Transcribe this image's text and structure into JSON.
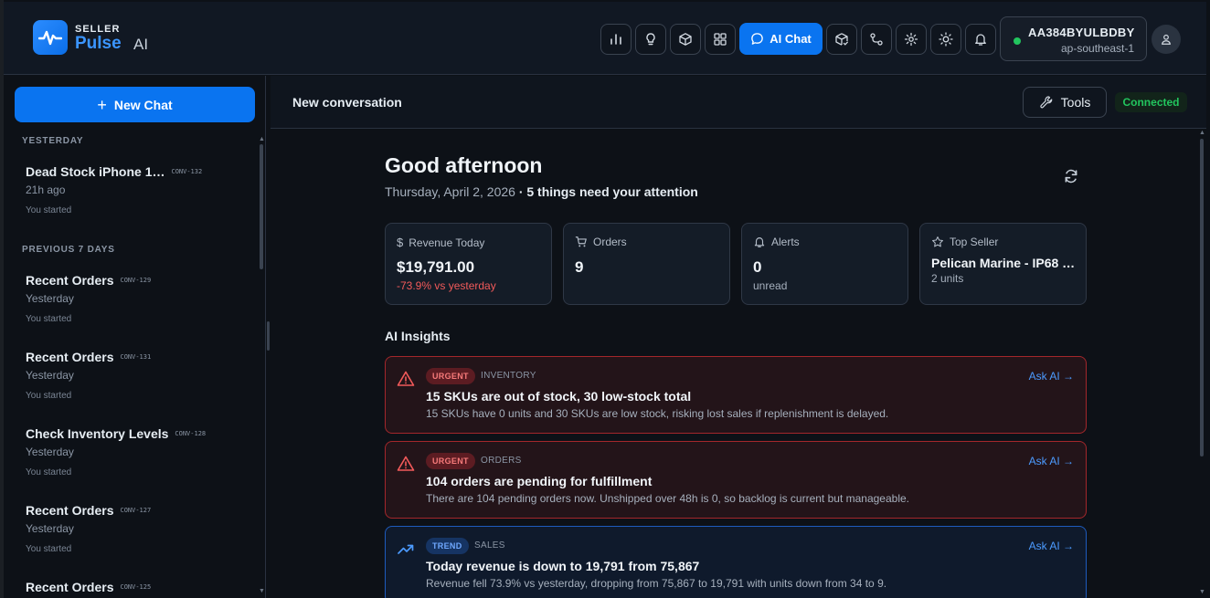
{
  "brand": {
    "top": "SELLER",
    "name": "Pulse",
    "suffix": "AI"
  },
  "header": {
    "ai_chat_label": "AI Chat",
    "account_id": "AA384BYULBDBY",
    "region": "ap-southeast-1",
    "status_color": "#22c55e",
    "accent": "#0a74f0"
  },
  "sidebar": {
    "new_chat_label": "New Chat",
    "sections": [
      {
        "label": "YESTERDAY"
      },
      {
        "label": "PREVIOUS 7 DAYS"
      }
    ],
    "conversations": [
      {
        "title": "Dead Stock iPhone 1…",
        "id": "CONV-132",
        "time": "21h ago",
        "who": "You started"
      },
      {
        "title": "Recent Orders",
        "id": "CONV-129",
        "time": "Yesterday",
        "who": "You started"
      },
      {
        "title": "Recent Orders",
        "id": "CONV-131",
        "time": "Yesterday",
        "who": "You started"
      },
      {
        "title": "Check Inventory Levels",
        "id": "CONV-128",
        "time": "Yesterday",
        "who": "You started"
      },
      {
        "title": "Recent Orders",
        "id": "CONV-127",
        "time": "Yesterday",
        "who": "You started"
      },
      {
        "title": "Recent Orders",
        "id": "CONV-125",
        "time": "",
        "who": ""
      }
    ]
  },
  "topbar": {
    "title": "New conversation",
    "tools_label": "Tools",
    "status": "Connected"
  },
  "dashboard": {
    "greeting": "Good afternoon",
    "date": "Thursday, April 2, 2026",
    "attention": "· 5 things need your attention",
    "stats": [
      {
        "label": "Revenue Today",
        "value": "$19,791.00",
        "sub": "-73.9% vs yesterday",
        "icon": "dollar-icon"
      },
      {
        "label": "Orders",
        "value": "9",
        "sub": "",
        "icon": "cart-icon"
      },
      {
        "label": "Alerts",
        "value": "0",
        "sub": "unread",
        "icon": "bell-icon"
      },
      {
        "label": "Top Seller",
        "value": "Pelican Marine - IP68 …",
        "sub": "2 units",
        "icon": "star-icon"
      }
    ],
    "insights_title": "AI Insights",
    "insights": [
      {
        "badge": "URGENT",
        "category": "INVENTORY",
        "title": "15 SKUs are out of stock, 30 low-stock total",
        "desc": "15 SKUs have 0 units and 30 SKUs are low stock, risking lost sales if replenishment is delayed.",
        "action": "Ask AI →"
      },
      {
        "badge": "URGENT",
        "category": "ORDERS",
        "title": "104 orders are pending for fulfillment",
        "desc": "There are 104 pending orders now. Unshipped over 48h is 0, so backlog is current but manageable.",
        "action": "Ask AI →"
      },
      {
        "badge": "TREND",
        "category": "SALES",
        "title": "Today revenue is down to 19,791 from 75,867",
        "desc": "Revenue fell 73.9% vs yesterday, dropping from 75,867 to 19,791 with units down from 34 to 9.",
        "action": "Ask AI →"
      }
    ]
  }
}
